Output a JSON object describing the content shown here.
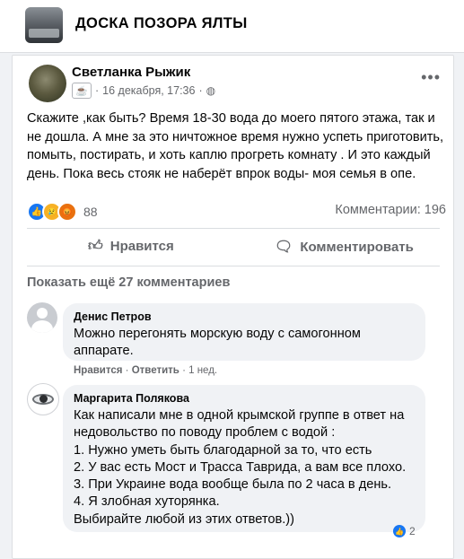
{
  "group": {
    "title": "ДОСКА ПОЗОРА ЯЛТЫ"
  },
  "post": {
    "author": "Светланка Рыжик",
    "date": "16 декабря, 17:36",
    "separator": "·",
    "text": "Скажите ,как быть? Время 18-30 вода до моего пятого этажа, так и не дошла. А мне за это ничтожное время нужно успеть приготовить, помыть, постирать, и хоть каплю прогреть комнату . И это каждый день. Пока весь стояк не наберёт впрок воды- моя семья в опе.",
    "reactions_count": "88",
    "comments_count": "Комментарии: 196",
    "reaction_icons": [
      "like-icon",
      "sad-icon",
      "angry-icon"
    ]
  },
  "actions": {
    "like": "Нравится",
    "comment": "Комментировать"
  },
  "show_more": "Показать ещё 27 комментариев",
  "comments": [
    {
      "name": "Денис Петров",
      "text": "Можно перегонять морскую воду с самогонном аппарате.",
      "like": "Нравится",
      "reply": "Ответить",
      "time": "1 нед.",
      "sep": "·"
    },
    {
      "name": "Маргарита Полякова",
      "text": "Как написали мне в одной крымской группе в ответ на недовольство по поводу проблем с водой :\n1. Нужно уметь быть благодарной за то, что есть\n2. У вас есть Мост и Трасса Таврида, а вам все плохо.\n3. При Украине вода вообще была по 2 часа в день.\n4. Я злобная хуторянка.\nВыбирайте любой из этих ответов.))",
      "reactions": "2"
    }
  ],
  "colors": {
    "accent": "#1877f2",
    "muted": "#65676b",
    "bubble": "#f0f2f5"
  }
}
